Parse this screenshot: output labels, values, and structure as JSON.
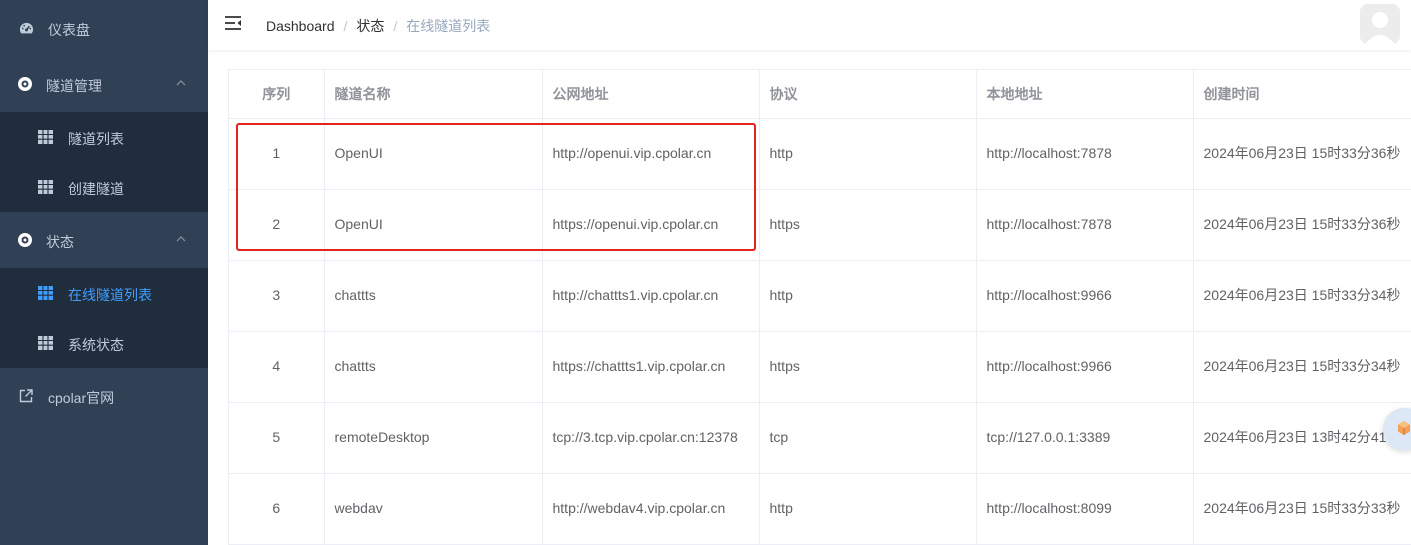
{
  "sidebar": {
    "items": [
      {
        "label": "仪表盘",
        "icon": "dashboard-icon"
      },
      {
        "label": "隧道管理",
        "icon": "compass-icon",
        "expanded": true,
        "children": [
          {
            "label": "隧道列表",
            "icon": "table-icon"
          },
          {
            "label": "创建隧道",
            "icon": "table-icon"
          }
        ]
      },
      {
        "label": "状态",
        "icon": "compass-icon",
        "expanded": true,
        "children": [
          {
            "label": "在线隧道列表",
            "icon": "table-icon",
            "active": true
          },
          {
            "label": "系统状态",
            "icon": "table-icon"
          }
        ]
      },
      {
        "label": "cpolar官网",
        "icon": "external-link-icon"
      }
    ]
  },
  "navbar": {
    "breadcrumb": [
      "Dashboard",
      "状态",
      "在线隧道列表"
    ]
  },
  "table": {
    "headers": [
      "序列",
      "隧道名称",
      "公网地址",
      "协议",
      "本地地址",
      "创建时间"
    ],
    "rows": [
      [
        "1",
        "OpenUI",
        "http://openui.vip.cpolar.cn",
        "http",
        "http://localhost:7878",
        "2024年06月23日 15时33分36秒"
      ],
      [
        "2",
        "OpenUI",
        "https://openui.vip.cpolar.cn",
        "https",
        "http://localhost:7878",
        "2024年06月23日 15时33分36秒"
      ],
      [
        "3",
        "chattts",
        "http://chattts1.vip.cpolar.cn",
        "http",
        "http://localhost:9966",
        "2024年06月23日 15时33分34秒"
      ],
      [
        "4",
        "chattts",
        "https://chattts1.vip.cpolar.cn",
        "https",
        "http://localhost:9966",
        "2024年06月23日 15时33分34秒"
      ],
      [
        "5",
        "remoteDesktop",
        "tcp://3.tcp.vip.cpolar.cn:12378",
        "tcp",
        "tcp://127.0.0.1:3389",
        "2024年06月23日 13时42分41秒"
      ],
      [
        "6",
        "webdav",
        "http://webdav4.vip.cpolar.cn",
        "http",
        "http://localhost:8099",
        "2024年06月23日 15时33分33秒"
      ]
    ]
  },
  "colors": {
    "sidebar_bg": "#304156",
    "submenu_bg": "#1f2d3d",
    "active": "#409eff",
    "highlight_box": "#e5231f"
  }
}
